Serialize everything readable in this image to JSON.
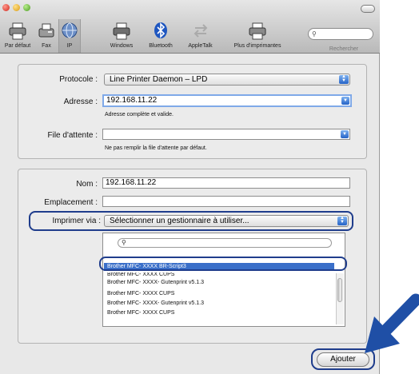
{
  "toolbar": {
    "items": [
      {
        "label": "Par défaut",
        "icon": "printer-icon"
      },
      {
        "label": "Fax",
        "icon": "fax-icon"
      },
      {
        "label": "IP",
        "icon": "globe-icon"
      },
      {
        "label": "Windows",
        "icon": "printer-icon"
      },
      {
        "label": "Bluetooth",
        "icon": "bluetooth-icon"
      },
      {
        "label": "AppleTalk",
        "icon": "appletalk-icon"
      },
      {
        "label": "Plus d'imprimantes",
        "icon": "printer-icon"
      }
    ],
    "selected": "IP",
    "search_label": "Rechercher"
  },
  "connection": {
    "protocole_label": "Protocole :",
    "protocole_value": "Line Printer Daemon – LPD",
    "adresse_label": "Adresse :",
    "adresse_value": "192.168.11.22",
    "adresse_hint": "Adresse complète et valide.",
    "file_label": "File d'attente :",
    "file_value": "",
    "file_hint": "Ne pas remplir la file d'attente par défaut."
  },
  "printer": {
    "nom_label": "Nom :",
    "nom_value": "192.168.11.22",
    "emplacement_label": "Emplacement :",
    "emplacement_value": "",
    "imprimer_label": "Imprimer via :",
    "imprimer_value": "Sélectionner un gestionnaire à utiliser..."
  },
  "drivers": [
    "Brother MFC- XXXX BR-Script3",
    "Brother MFC- XXXX CUPS",
    "Brother MFC- XXXX- Gutenprint v5.1.3",
    "Brother MFC- XXXX CUPS",
    "Brother MFC- XXXX- Gutenprint v5.1.3",
    "Brother MFC- XXXX CUPS"
  ],
  "actions": {
    "add_label": "Ajouter"
  },
  "colors": {
    "highlight": "#1f3d8c",
    "selection": "#3a6fc9",
    "arrow": "#1f4fa6"
  }
}
